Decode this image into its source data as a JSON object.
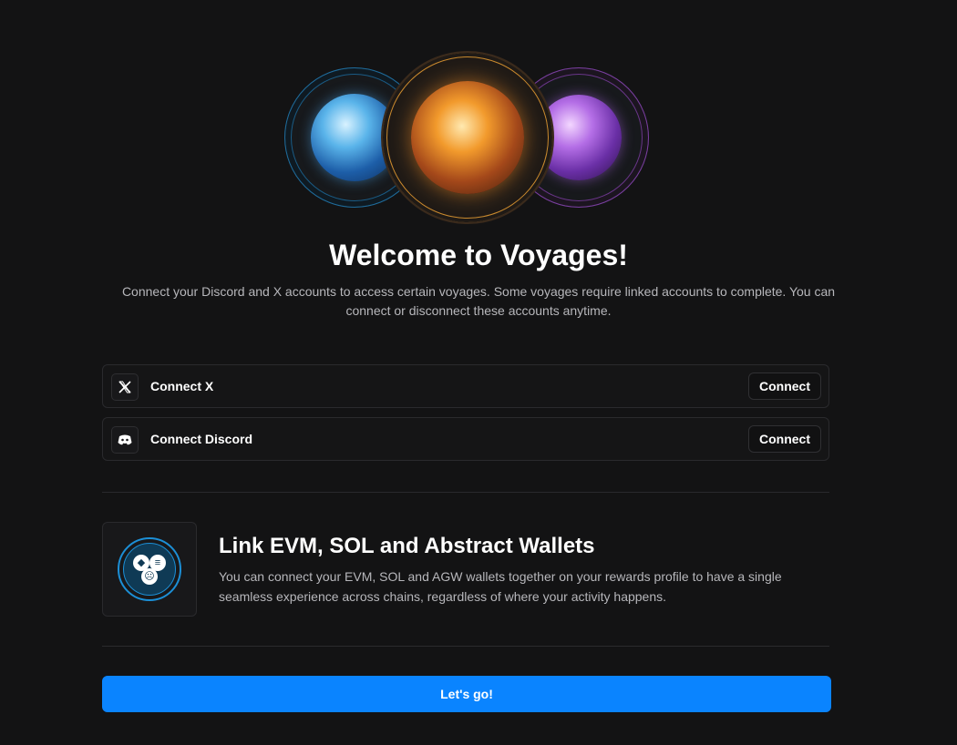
{
  "hero": {
    "orbs": [
      {
        "name": "water",
        "icon": "water-orb-icon",
        "color": "#5ab4ea"
      },
      {
        "name": "fire",
        "icon": "fire-orb-icon",
        "color": "#f29a2c"
      },
      {
        "name": "void",
        "icon": "void-orb-icon",
        "color": "#b46ee6"
      }
    ],
    "title": "Welcome to Voyages!",
    "subtitle": "Connect your Discord and X accounts to access certain voyages. Some voyages require linked accounts to complete. You can connect or disconnect these accounts anytime."
  },
  "connections": {
    "x": {
      "label": "Connect X",
      "button": "Connect",
      "icon": "x-logo-icon"
    },
    "discord": {
      "label": "Connect Discord",
      "button": "Connect",
      "icon": "discord-logo-icon"
    }
  },
  "wallets": {
    "icon": "wallet-link-icon",
    "title": "Link EVM, SOL and Abstract Wallets",
    "description": "You can connect your EVM, SOL and AGW wallets together on your rewards profile to have a single seamless experience across chains, regardless of where your activity happens."
  },
  "cta": {
    "label": "Let's go!",
    "color": "#0a84ff"
  }
}
